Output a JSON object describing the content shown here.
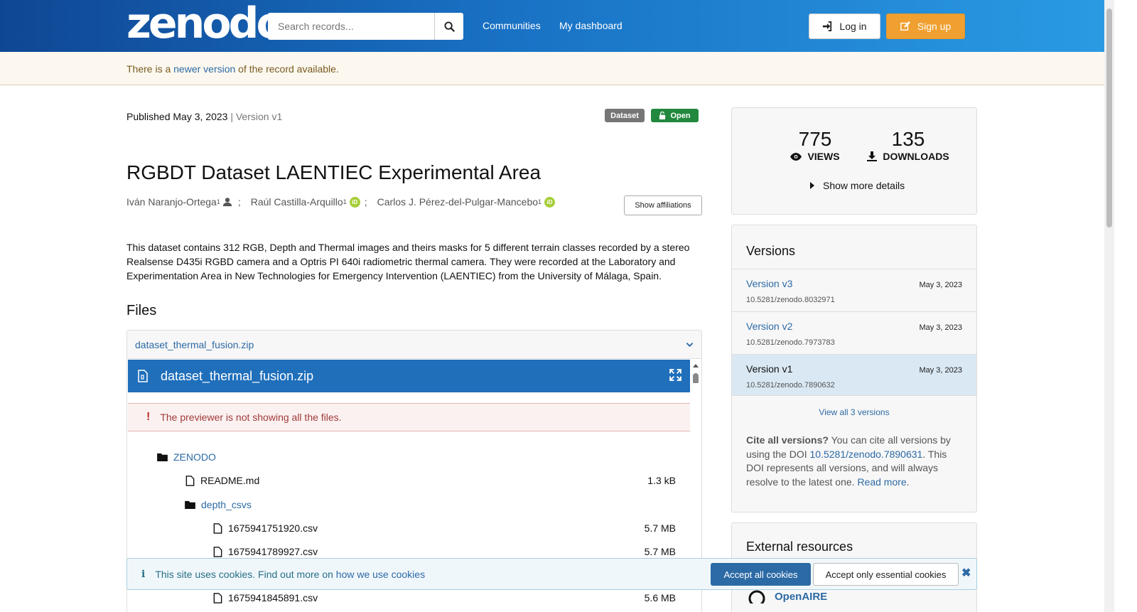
{
  "header": {
    "logo": "zenodo",
    "search_placeholder": "Search records...",
    "nav": [
      "Communities",
      "My dashboard"
    ],
    "login_label": "Log in",
    "signup_label": "Sign up"
  },
  "notice": {
    "prefix": "There is a ",
    "link": "newer version",
    "suffix": " of the record available."
  },
  "record": {
    "published": "Published May 3, 2023",
    "version": "| Version v1",
    "badge_type": "Dataset",
    "badge_access": "Open",
    "title": "RGBDT Dataset LAENTIEC Experimental Area",
    "authors": [
      {
        "name": "Iván Naranjo-Ortega",
        "aff": "1"
      },
      {
        "name": "Raúl Castilla-Arquillo",
        "aff": "1"
      },
      {
        "name": "Carlos J. Pérez-del-Pulgar-Mancebo",
        "aff": "1"
      }
    ],
    "show_affiliations": "Show affiliations",
    "description": "This dataset contains 312 RGB, Depth and Thermal images and theirs masks for 5 different terrain classes recorded by a stereo Realsense D435i RGBD camera and a Optris PI 640i radiometric thermal camera. They were recorded at the Laboratory and Experimentation Area in New Technologies for Emergency Intervention (LAENTIEC) from the University of Málaga, Spain."
  },
  "files": {
    "heading": "Files",
    "filename": "dataset_thermal_fusion.zip",
    "preview_title": "dataset_thermal_fusion.zip",
    "warning": "The previewer is not showing all the files.",
    "tree": [
      {
        "name": "ZENODO",
        "type": "folder",
        "size": ""
      },
      {
        "name": "README.md",
        "type": "file",
        "size": "1.3 kB"
      },
      {
        "name": "depth_csvs",
        "type": "folder",
        "size": ""
      },
      {
        "name": "1675941751920.csv",
        "type": "file",
        "size": "5.7 MB"
      },
      {
        "name": "1675941789927.csv",
        "type": "file",
        "size": "5.7 MB"
      },
      {
        "name": "1675941845891.csv",
        "type": "file",
        "size": "5.6 MB"
      }
    ]
  },
  "stats": {
    "views": "775",
    "views_label": "VIEWS",
    "downloads": "135",
    "downloads_label": "DOWNLOADS",
    "more": "Show more details"
  },
  "versions": {
    "heading": "Versions",
    "items": [
      {
        "name": "Version v3",
        "date": "May 3, 2023",
        "doi": "10.5281/zenodo.8032971"
      },
      {
        "name": "Version v2",
        "date": "May 3, 2023",
        "doi": "10.5281/zenodo.7973783"
      },
      {
        "name": "Version v1",
        "date": "May 3, 2023",
        "doi": "10.5281/zenodo.7890632"
      }
    ],
    "view_all": "View all 3 versions",
    "cite_bold": "Cite all versions?",
    "cite_text1": " You can cite all versions by using the DOI ",
    "cite_doi": "10.5281/zenodo.7890631",
    "cite_text2": ". This DOI represents all versions, and will always resolve to the latest one. ",
    "read_more": "Read more",
    "read_more_suffix": "."
  },
  "external": {
    "heading": "External resources",
    "openaire": "OpenAIRE"
  },
  "cookie": {
    "text": "This site uses cookies. Find out more on ",
    "link": "how we use cookies",
    "accept_all": "Accept all cookies",
    "accept_essential": "Accept only essential cookies"
  }
}
